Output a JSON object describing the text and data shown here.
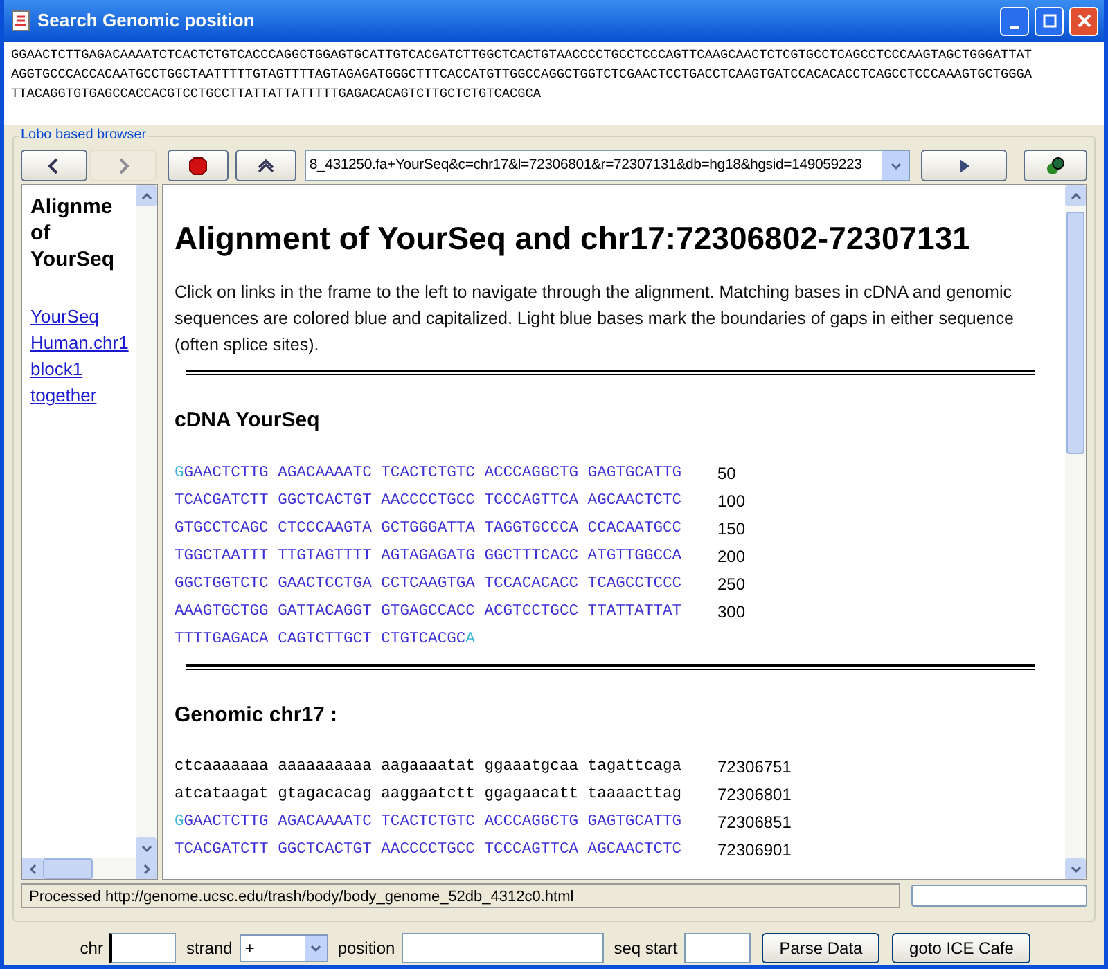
{
  "window": {
    "title": "Search Genomic position"
  },
  "sequence_text": [
    "GGAACTCTTGAGACAAAATCTCACTCTGTCACCCAGGCTGGAGTGCATTGTCACGATCTTGGCTCACTGTAACCCCTGCCTCCCAGTTCAAGCAACTCTCGTGCCTCAGCCTCCCAAGTAGCTGGGATTAT",
    "AGGTGCCCACCACAATGCCTGGCTAATTTTTGTAGTTTTAGTAGAGATGGGCTTTCACCATGTTGGCCAGGCTGGTCTCGAACTCCTGACCTCAAGTGATCCACACACCTCAGCCTCCCAAAGTGCTGGGA",
    "TTACAGGTGTGAGCCACCACGTCCTGCCTTATTATTATTTTTGAGACACAGTCTTGCTCTGTCACGCA"
  ],
  "browser": {
    "group_label": "Lobo based browser",
    "nav_buttons": [
      {
        "kind": "back",
        "disabled": false
      },
      {
        "kind": "forward",
        "disabled": true
      },
      {
        "kind": "stop",
        "disabled": false
      },
      {
        "kind": "refresh",
        "disabled": false
      }
    ],
    "url": "8_431250.fa+YourSeq&c=chr17&l=72306801&r=72307131&db=hg18&hgsid=149059223",
    "action_buttons": [
      {
        "kind": "go"
      },
      {
        "kind": "tools"
      }
    ],
    "left_frame": {
      "heading": "Alignme of YourSeq",
      "links": [
        "YourSeq",
        "Human.chr1",
        "block1",
        "together"
      ]
    },
    "main_frame": {
      "title": "Alignment of YourSeq and chr17:72306802-72307131",
      "intro": "Click on links in the frame to the left to navigate through the alignment. Matching bases in cDNA and genomic sequences are colored blue and capitalized. Light blue bases mark the boundaries of gaps in either sequence (often splice sites).",
      "sections": [
        {
          "heading": "cDNA YourSeq",
          "rows": [
            {
              "segments": [
                {
                  "text": "G",
                  "kind": "boundary"
                },
                {
                  "text": "GAACTCTTG AGACAAAATC TCACTCTGTC ACCCAGGCTG GAGTGCATTG",
                  "kind": "match"
                }
              ],
              "number": "50"
            },
            {
              "segments": [
                {
                  "text": "TCACGATCTT GGCTCACTGT AACCCCTGCC TCCCAGTTCA AGCAACTCTC",
                  "kind": "match"
                }
              ],
              "number": "100"
            },
            {
              "segments": [
                {
                  "text": "GTGCCTCAGC CTCCCAAGTA GCTGGGATTA TAGGTGCCCA CCACAATGCC",
                  "kind": "match"
                }
              ],
              "number": "150"
            },
            {
              "segments": [
                {
                  "text": "TGGCTAATTT TTGTAGTTTT AGTAGAGATG GGCTTTCACC ATGTTGGCCA",
                  "kind": "match"
                }
              ],
              "number": "200"
            },
            {
              "segments": [
                {
                  "text": "GGCTGGTCTC GAACTCCTGA CCTCAAGTGA TCCACACACC TCAGCCTCCC",
                  "kind": "match"
                }
              ],
              "number": "250"
            },
            {
              "segments": [
                {
                  "text": "AAAGTGCTGG GATTACAGGT GTGAGCCACC ACGTCCTGCC TTATTATTAT",
                  "kind": "match"
                }
              ],
              "number": "300"
            },
            {
              "segments": [
                {
                  "text": "TTTTGAGACA CAGTCTTGCT CTGTCACGC",
                  "kind": "match"
                },
                {
                  "text": "A",
                  "kind": "boundary"
                }
              ]
            }
          ]
        },
        {
          "heading": "Genomic chr17 :",
          "rows": [
            {
              "segments": [
                {
                  "text": "ctcaaaaaaa aaaaaaaaaa aagaaaatat ggaaatgcaa tagattcaga",
                  "kind": "plain"
                }
              ],
              "number": "72306751"
            },
            {
              "segments": [
                {
                  "text": "atcataagat gtagacacag aaggaatctt ggagaacatt taaaacttag",
                  "kind": "plain"
                }
              ],
              "number": "72306801"
            },
            {
              "segments": [
                {
                  "text": "G",
                  "kind": "boundary"
                },
                {
                  "text": "GAACTCTTG AGACAAAATC TCACTCTGTC ACCCAGGCTG GAGTGCATTG",
                  "kind": "match"
                }
              ],
              "number": "72306851"
            },
            {
              "segments": [
                {
                  "text": "TCACGATCTT GGCTCACTGT AACCCCTGCC TCCCAGTTCA AGCAACTCTC",
                  "kind": "match"
                }
              ],
              "number": "72306901"
            }
          ]
        }
      ]
    },
    "status": "Processed http://genome.ucsc.edu/trash/body/body_genome_52db_4312c0.html"
  },
  "form": {
    "fields": [
      {
        "kind": "text",
        "label": "chr",
        "focused": true
      },
      {
        "kind": "select",
        "label": "strand",
        "value": "+"
      },
      {
        "kind": "text",
        "label": "position",
        "focused": false
      },
      {
        "kind": "text",
        "label": "seq start",
        "focused": false
      }
    ],
    "buttons": [
      "Parse Data",
      "goto ICE Cafe"
    ]
  }
}
